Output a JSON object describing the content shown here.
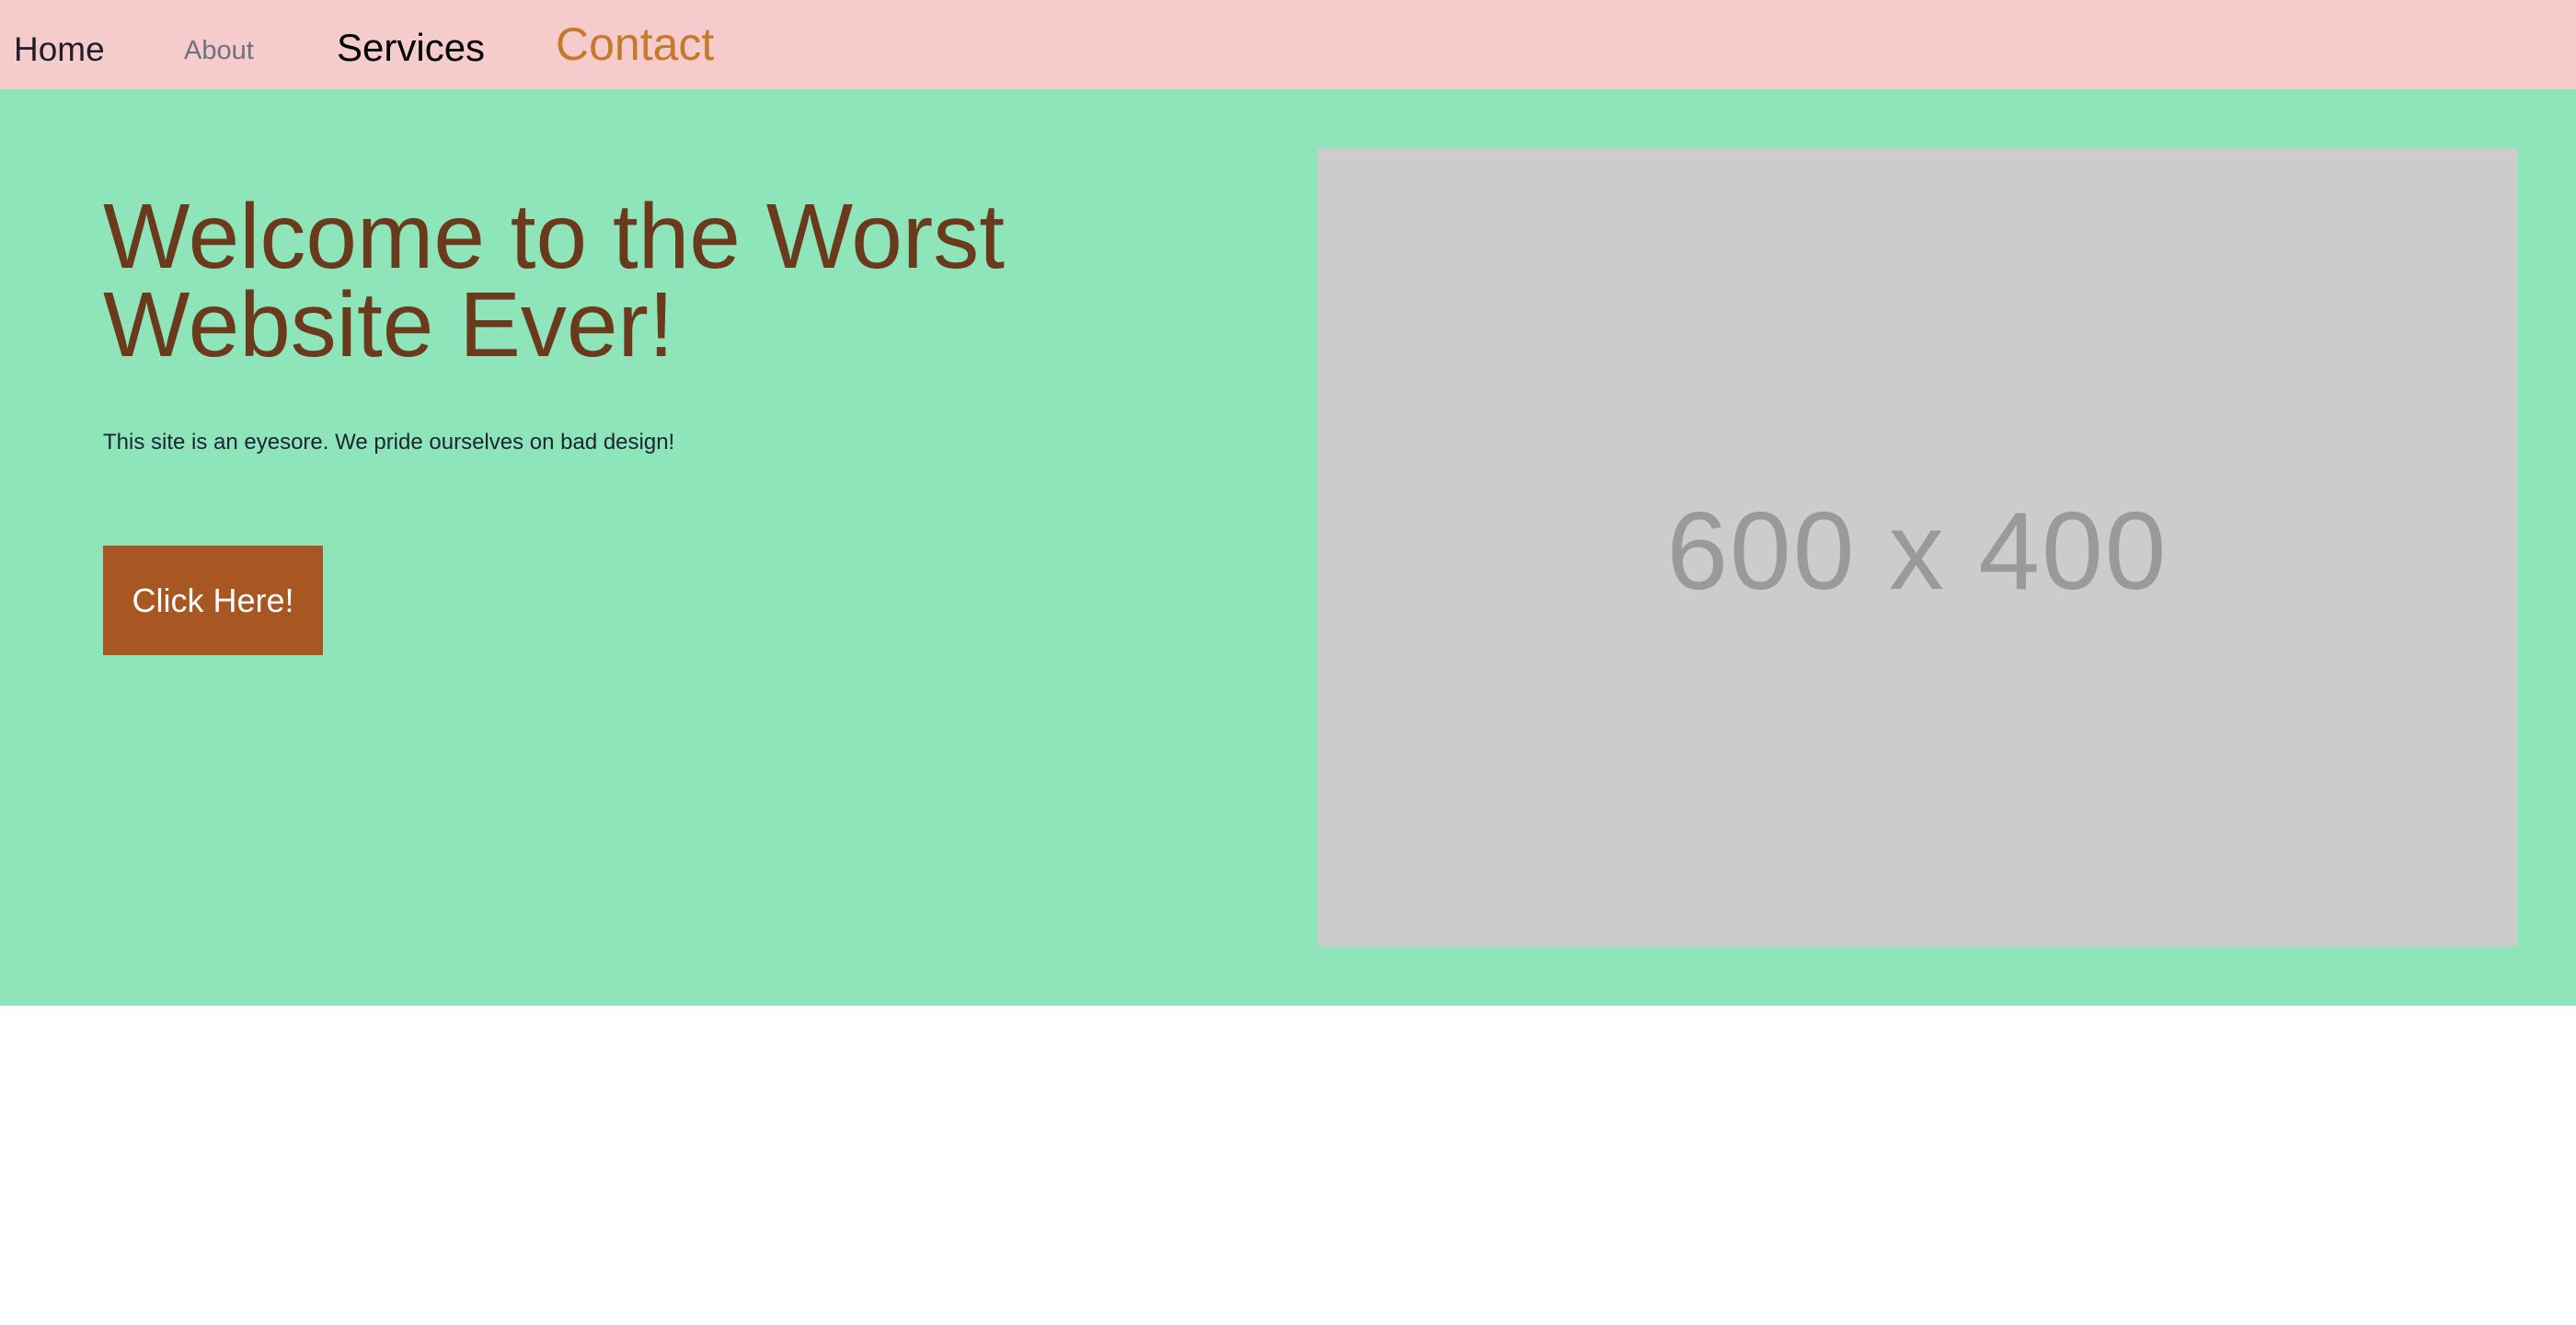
{
  "nav": {
    "items": [
      {
        "label": "Home",
        "color": "#1f1f2e"
      },
      {
        "label": "About",
        "color": "#6b7280"
      },
      {
        "label": "Services",
        "color": "#000000"
      },
      {
        "label": "Contact",
        "color": "#c47a2a"
      }
    ],
    "background": "#f6cbcb"
  },
  "hero": {
    "title": "Welcome to the Worst Website Ever!",
    "subtitle": "This site is an eyesore. We pride ourselves on bad design!",
    "button_label": "Click Here!",
    "image_placeholder": "600 x 400",
    "background": "#8fe5ba",
    "title_color": "#6b3a1c",
    "button_color": "#a85722"
  }
}
